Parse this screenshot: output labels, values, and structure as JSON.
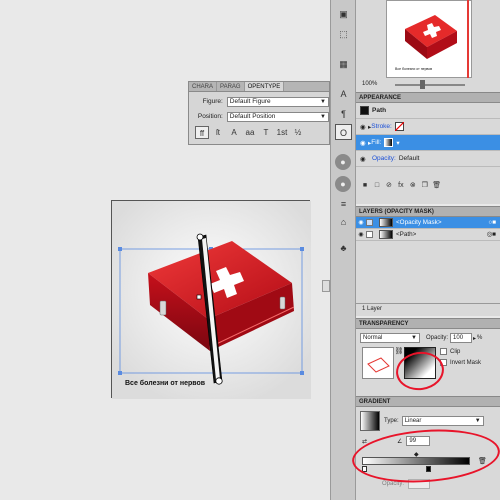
{
  "canvas": {
    "artboard_caption": "Все болезни от нервов"
  },
  "opentype_panel": {
    "tabs": [
      "CHARA",
      "PARAG",
      "OPENTYPE"
    ],
    "figure_label": "Figure:",
    "figure_value": "Default Figure",
    "position_label": "Position:",
    "position_value": "Default Position",
    "icons": [
      "ff",
      "ſt",
      "A",
      "aa",
      "T",
      "1st",
      "½"
    ]
  },
  "navigator": {
    "zoom": "100%",
    "thumb_caption": "Все болезни от нервов"
  },
  "appearance": {
    "title": "APPEARANCE",
    "object": "Path",
    "stroke_label": "Stroke:",
    "fill_label": "Fill:",
    "opacity_label": "Opacity:",
    "opacity_value": "Default"
  },
  "layers": {
    "title": "LAYERS (OPACITY MASK)",
    "rows": [
      {
        "name": "<Opacity Mask>"
      },
      {
        "name": "<Path>"
      }
    ],
    "footer": "1 Layer"
  },
  "transparency": {
    "title": "TRANSPARENCY",
    "blend_mode": "Normal",
    "opacity_label": "Opacity:",
    "opacity_value": "100",
    "opacity_unit": "%",
    "clip_label": "Clip",
    "invert_label": "Invert Mask"
  },
  "gradient": {
    "title": "GRADIENT",
    "type_label": "Type:",
    "type_value": "Linear",
    "angle_value": "99",
    "opacity_label": "Opacity:"
  },
  "colors": {
    "accent_blue": "#3b8fe4",
    "box_red": "#d3121e",
    "annotation_red": "#e8142a"
  }
}
